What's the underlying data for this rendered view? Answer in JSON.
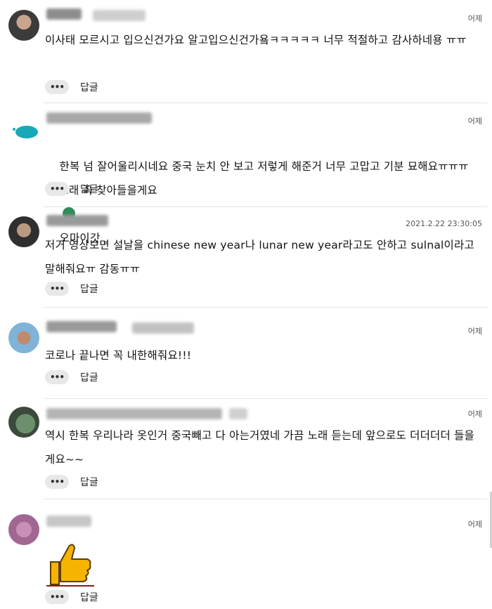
{
  "comments": [
    {
      "time": "어제",
      "text": "이사태 모르시고 입으신건가요 알고입으신건가욬ㅋㅋㅋㅋㅋ 너무 적절하고 감사하네용 ㅠㅠ",
      "more": "•••",
      "reply": "답글"
    },
    {
      "time": "어제",
      "text_a": "한복 넘 잘어울리시네요 중국 눈치 안 보고 저렇게 해준거 너무 고맙고 기분 묘해요ㅠㅠㅠㅠ 노래 꼭 찾아들을게요",
      "text_b": "오마이갓",
      "more": "•••",
      "reply": "답글"
    },
    {
      "time": "2021.2.22 23:30:05",
      "text": "저거 영상보면 설날을 chinese new year나 lunar new year라고도 안하고 sulnal이라고 말해줘요ㅠ 감동ㅠㅠ",
      "more": "•••",
      "reply": "답글"
    },
    {
      "time": "어제",
      "text": "코로나 끝나면 꼭 내한해줘요!!!",
      "more": "•••",
      "reply": "답글"
    },
    {
      "time": "어제",
      "text": "역시 한복 우리나라 옷인거 중국빼고 다 아는거였네 가끔 노래 듣는데 앞으로도 더더더더 들을게요~~",
      "more": "•••",
      "reply": "답글"
    },
    {
      "time": "어제",
      "more": "•••",
      "reply": "답글"
    }
  ]
}
